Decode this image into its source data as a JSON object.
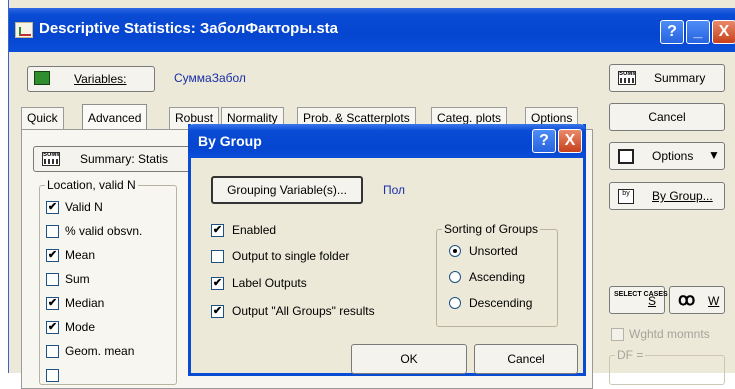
{
  "window": {
    "title": "Descriptive Statistics: ЗаболФакторы.sta",
    "help_label": "?",
    "minimize_label": "_",
    "close_label": "X"
  },
  "variables": {
    "button_label": "Variables:",
    "value": "СуммаЗабол"
  },
  "tabs": [
    {
      "label": "Quick"
    },
    {
      "label": "Advanced"
    },
    {
      "label": "Robust"
    },
    {
      "label": "Normality"
    },
    {
      "label": "Prob. & Scatterplots"
    },
    {
      "label": "Categ. plots"
    },
    {
      "label": "Options"
    }
  ],
  "summary_stats_button": "Summary: Statis",
  "location_group": {
    "title": "Location, valid N",
    "items": [
      {
        "label": "Valid N",
        "checked": "✔"
      },
      {
        "label": "% valid obsvn.",
        "checked": ""
      },
      {
        "label": "Mean",
        "checked": "✔"
      },
      {
        "label": "Sum",
        "checked": ""
      },
      {
        "label": "Median",
        "checked": "✔"
      },
      {
        "label": "Mode",
        "checked": "✔"
      },
      {
        "label": "Geom. mean",
        "checked": ""
      }
    ]
  },
  "right_panel": {
    "summary_label": "Summary",
    "cancel_label": "Cancel",
    "options_label": "Options",
    "by_group_label": "By Group...",
    "select_cases_icon_text": "SELECT CASES",
    "s_label": "S",
    "w_label": "W",
    "wghtd_moments_label": "Wghtd momnts",
    "df_label": "DF ="
  },
  "dialog": {
    "title": "By Group",
    "help_label": "?",
    "close_label": "X",
    "grouping_button_label": "Grouping Variable(s)...",
    "grouping_value": "Пол",
    "checkboxes": [
      {
        "label": "Enabled",
        "checked": "✔"
      },
      {
        "label": "Output to single folder",
        "checked": ""
      },
      {
        "label": "Label Outputs",
        "checked": "✔"
      },
      {
        "label": "Output \"All Groups\" results",
        "checked": "✔"
      }
    ],
    "sorting_group": {
      "title": "Sorting of Groups",
      "options": [
        {
          "label": "Unsorted",
          "selected": true
        },
        {
          "label": "Ascending",
          "selected": false
        },
        {
          "label": "Descending",
          "selected": false
        }
      ]
    },
    "ok_label": "OK",
    "cancel_label": "Cancel"
  }
}
